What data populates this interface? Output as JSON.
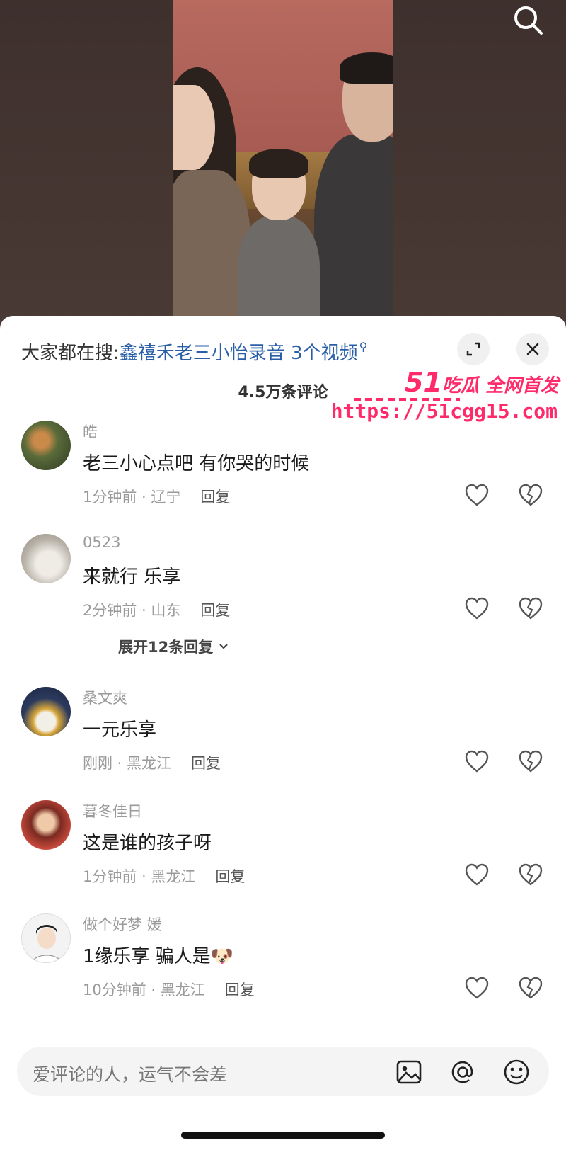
{
  "search": {
    "prefix": "大家都在搜:",
    "query": "鑫禧禾老三小怡录音 3个视频"
  },
  "comments_header": {
    "count": "4.5万条评论"
  },
  "watermark": {
    "brand_number": "51",
    "brand_text": "吃瓜 全网首发",
    "url": "https://51cgg15.com"
  },
  "comments": [
    {
      "name": "皓",
      "text": "老三小心点吧 有你哭的时候",
      "meta": "1分钟前 · 辽宁",
      "reply": "回复",
      "avatar_color": "#5a6b3a"
    },
    {
      "name": "0523",
      "text": "来就行 乐享",
      "meta": "2分钟前 · 山东",
      "reply": "回复",
      "avatar_color": "#c9c5bf",
      "expand": "展开12条回复"
    },
    {
      "name": "桑文爽",
      "text": "一元乐享",
      "meta": "刚刚 · 黑龙江",
      "reply": "回复",
      "avatar_color": "#2c3a5e"
    },
    {
      "name": "暮冬佳日",
      "text": "这是谁的孩子呀",
      "meta": "1分钟前 · 黑龙江",
      "reply": "回复",
      "avatar_color": "#c4473a"
    },
    {
      "name": "做个好梦 媛",
      "text": "1缘乐享 骗人是🐶",
      "meta": "10分钟前 · 黑龙江",
      "reply": "回复",
      "avatar_color": "#e8e8e8"
    }
  ],
  "input": {
    "placeholder": "爱评论的人，运气不会差"
  },
  "icons": {
    "top_search": "search-icon",
    "expand": "expand-icon",
    "close": "close-icon",
    "like": "heart-icon",
    "dislike": "broken-heart-icon",
    "image": "image-icon",
    "mention": "at-icon",
    "emoji": "emoji-icon"
  }
}
